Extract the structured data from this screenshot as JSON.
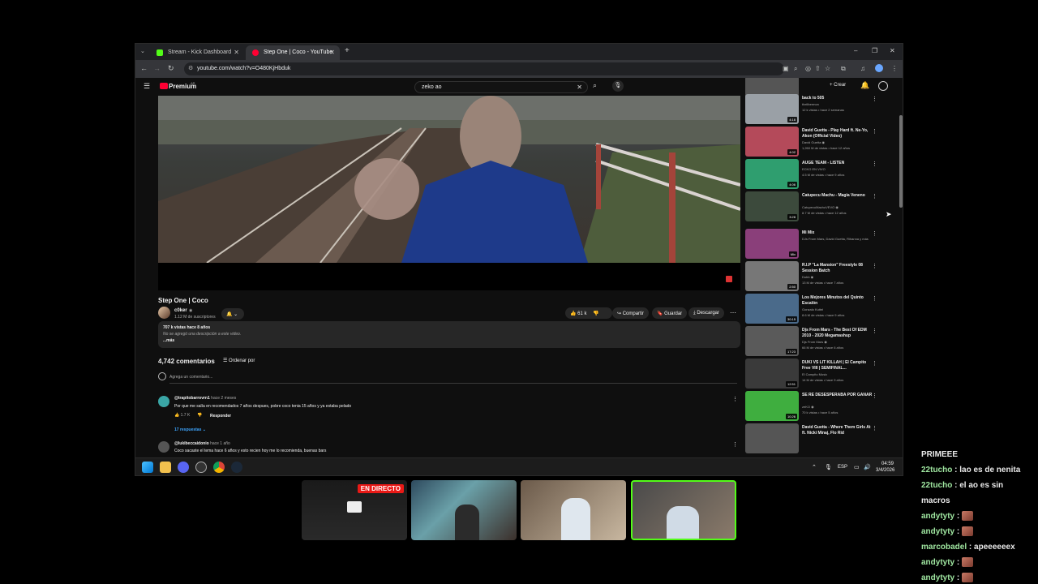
{
  "browser": {
    "tabs": [
      {
        "title": "Stream - Kick Dashboard",
        "active": false,
        "favicon_color": "#53fc18"
      },
      {
        "title": "Step One | Coco - YouTube",
        "active": true,
        "favicon_color": "#ff0033"
      }
    ],
    "url": "youtube.com/watch?v=O480KjHbduk",
    "new_tab": "+",
    "window_controls": {
      "minimize": "–",
      "maximize": "❐",
      "close": "✕"
    }
  },
  "youtube": {
    "logo": "Premium",
    "logo_sup": "AR",
    "search_query": "zeko ao",
    "create_label": "Crear",
    "video_title": "Step One | Coco",
    "channel": {
      "name": "c0ker",
      "subs": "1.12 M de suscriptores"
    },
    "actions": {
      "likes": "61 k",
      "share": "Compartir",
      "save": "Guardar",
      "download": "Descargar"
    },
    "description": {
      "stats": "707 k vistas  hace 8 años",
      "text": "No se agregó una descripción a este video.",
      "more": "...más"
    },
    "comments": {
      "count": "4,742 comentarios",
      "sort": "Ordenar por",
      "add_placeholder": "Agrega un comentario...",
      "items": [
        {
          "author": "@trapitobarrovrn1",
          "time": "hace 2 meses",
          "text": "Por que me salía en recomendados 7 años despues, pobre coco tenia 15 años y ya estaba pelado",
          "likes": "1.7 K",
          "reply": "Responder",
          "replies": "17 respuestas"
        },
        {
          "author": "@lukibeccaidonio",
          "time": "hace 1 año",
          "text": "Coco sacaste el tema hace 6 años y esto recien hoy me lo recomienda, buenas bars"
        }
      ]
    },
    "recommendations": [
      {
        "title": "",
        "channel": "",
        "meta": "",
        "duration": "Mix",
        "thumb": "#555"
      },
      {
        "title": "back to 505",
        "channel": "thelibermon",
        "meta": "12 k vistas • hace 2 semanas",
        "duration": "4:16",
        "thumb": "#9aa0a6"
      },
      {
        "title": "David Guetta - Play Hard ft. Ne-Yo, Akon (Official Video)",
        "channel": "David Guetta ◉",
        "meta": "1,260 M de vistas • hace 12 años",
        "duration": "4:02",
        "thumb": "#b44a5a"
      },
      {
        "title": "AUGE TEAM - LISTEN",
        "channel": "ECKO EN VIVO",
        "meta": "4.5 M de vistas • hace 9 años",
        "duration": "4:06",
        "thumb": "#2f9e6f"
      },
      {
        "title": "Catupecu Machu - Magia Veneno",
        "channel": "CatupecuMachuVEVO ◉",
        "meta": "8.7 M de vistas • hace 12 años",
        "duration": "3:28",
        "thumb": "#3c4a3c"
      },
      {
        "title": "Mi Mix",
        "channel": "DJs From Mars, David Guetta, Rihanna y más",
        "meta": "",
        "duration": "Mix",
        "thumb": "#8a3f7a"
      },
      {
        "title": "R.I.P \"La Mansion\" Freestyle 08 Session Batch",
        "channel": "Dubb ◉",
        "meta": "13 M de vistas • hace 7 años",
        "duration": "2:50",
        "thumb": "#777"
      },
      {
        "title": "Los Mejores Minutos del Quinto Escalón",
        "channel": "Gonzalo Kuttel",
        "meta": "8.6 M de vistas • hace 9 años",
        "duration": "30:15",
        "thumb": "#4a6a8a"
      },
      {
        "title": "Djs From Mars - The Best Of EDM 2010 - 2020 Megamashup",
        "channel": "Djs From Mars ◉",
        "meta": "66 M de vistas • hace 6 años",
        "duration": "17:23",
        "thumb": "#5a5a5a"
      },
      {
        "title": "DUKI VS LIT KILLAH | El Campito Free VIII | SEMIFINAL...",
        "channel": "El Campito Music",
        "meta": "14 M de vistas • hace 9 años",
        "duration": "12:51",
        "thumb": "#3a3a3a"
      },
      {
        "title": "SE RE DESESPERABA POR GANAR",
        "channel": "zeKO ◉",
        "meta": "70 k vistas • hace 5 años",
        "duration": "10:26",
        "thumb": "#3fae3f"
      },
      {
        "title": "David Guetta - Where Them Girls At ft. Nicki Minaj, Flo Rid",
        "channel": "",
        "meta": "",
        "duration": "",
        "thumb": "#555"
      }
    ]
  },
  "taskbar": {
    "lang": "ESP",
    "time": "04:59",
    "date": "3/4/2026"
  },
  "stream": {
    "live_badge": "EN DIRECTO"
  },
  "chat": [
    {
      "user": "",
      "text": "PRIMEEE"
    },
    {
      "user": "22tucho",
      "text": ": lao es de nenita"
    },
    {
      "user": "22tucho",
      "text": ": el ao es sin"
    },
    {
      "user": "",
      "text": "macros"
    },
    {
      "user": "andytyty",
      "text": ":"
    },
    {
      "user": "andytyty",
      "text": ":"
    },
    {
      "user": "marcobadel",
      "text": ": apeeeeeex"
    },
    {
      "user": "andytyty",
      "text": ":"
    },
    {
      "user": "andytyty",
      "text": ":"
    }
  ]
}
